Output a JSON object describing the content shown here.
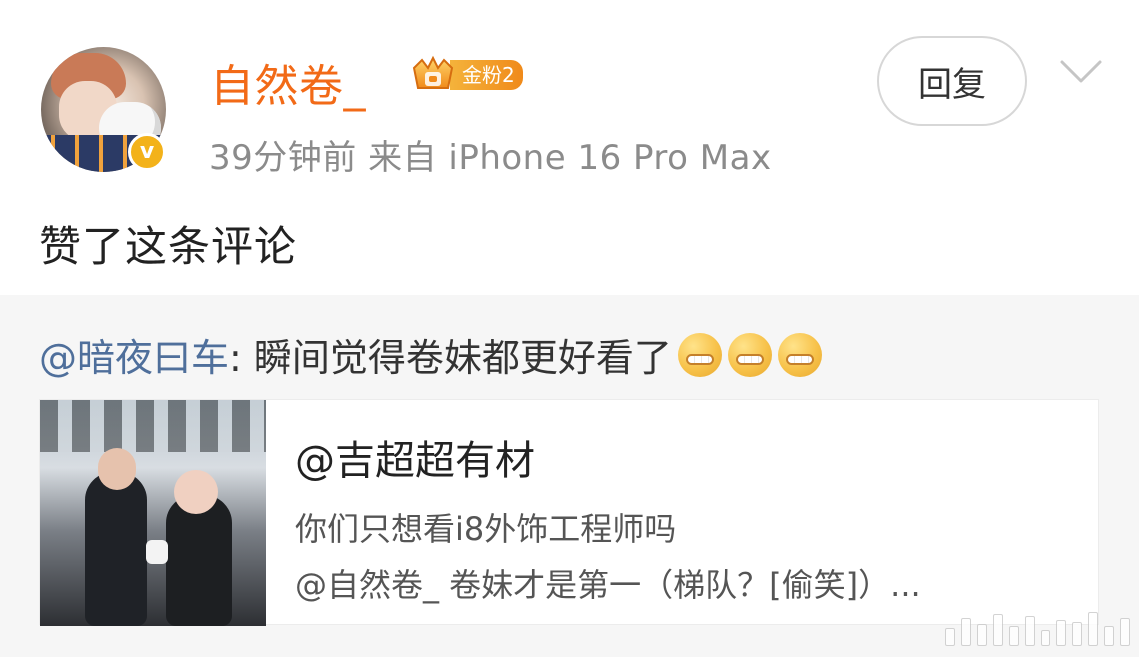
{
  "header": {
    "username": "自然卷_",
    "fan_badge": {
      "label": "金粉2"
    },
    "meta": "39分钟前  来自 iPhone 16 Pro Max",
    "reply_button": "回复",
    "status_text": "赞了这条评论"
  },
  "quoted": {
    "mention": "@暗夜曰车",
    "text": ": 瞬间觉得卷妹都更好看了",
    "emoji": [
      "grin",
      "grin",
      "grin"
    ],
    "card": {
      "title": "@吉超超有材",
      "line1": "你们只想看i8外饰工程师吗",
      "line2": "@自然卷_ 卷妹才是第一（梯队？[偷笑]）..."
    }
  },
  "colors": {
    "username": "#f26a17",
    "meta": "#8b8b8b",
    "mention": "#4f6f9b",
    "quoted_bg": "#f6f6f6",
    "badge_gradient_start": "#f4b33b",
    "badge_gradient_end": "#f08a1a"
  },
  "icons": [
    "verified-badge-icon",
    "fan-crown-icon",
    "chevron-down-icon",
    "grin-emoji-icon"
  ]
}
